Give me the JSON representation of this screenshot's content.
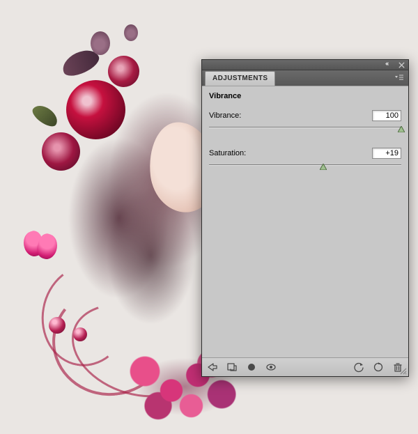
{
  "panel": {
    "tab_label": "ADJUSTMENTS",
    "title": "Vibrance",
    "sliders": {
      "vibrance": {
        "label": "Vibrance:",
        "value": "100",
        "min": -100,
        "max": 100,
        "pos_pct": 100
      },
      "saturation": {
        "label": "Saturation:",
        "value": "+19",
        "min": -100,
        "max": 100,
        "pos_pct": 59.5
      }
    },
    "footer_icons": {
      "back": "back-arrow-icon",
      "expand": "expand-view-icon",
      "clip": "clip-to-layer-icon",
      "visibility": "visibility-icon",
      "prev_state": "previous-state-icon",
      "reset": "reset-icon",
      "delete": "trash-icon"
    }
  }
}
